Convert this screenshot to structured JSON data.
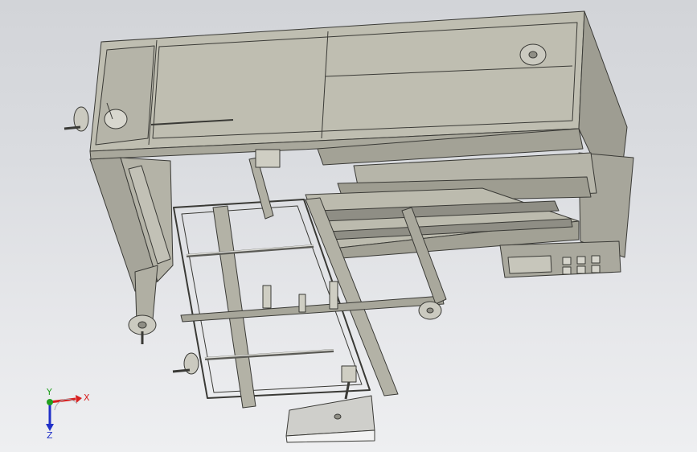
{
  "viewport": {
    "background_top": "#d2d4d8",
    "background_bottom": "#eeeff1"
  },
  "model": {
    "description_icon": "cad-assembly-machine",
    "colors": {
      "body": "#b9b8ab",
      "body_dark": "#9d9c90",
      "body_light": "#cfcec3",
      "edge": "#3a3a36",
      "steel": "#8f8e85",
      "shaft": "#c7c7c2",
      "panel": "#e8e8e6",
      "plate_white": "#f2f2f2"
    }
  },
  "triad": {
    "x_label": "X",
    "y_label": "Y",
    "z_label": "Z",
    "x_color": "#d82020",
    "y_color": "#22a020",
    "z_color": "#2030c8"
  }
}
